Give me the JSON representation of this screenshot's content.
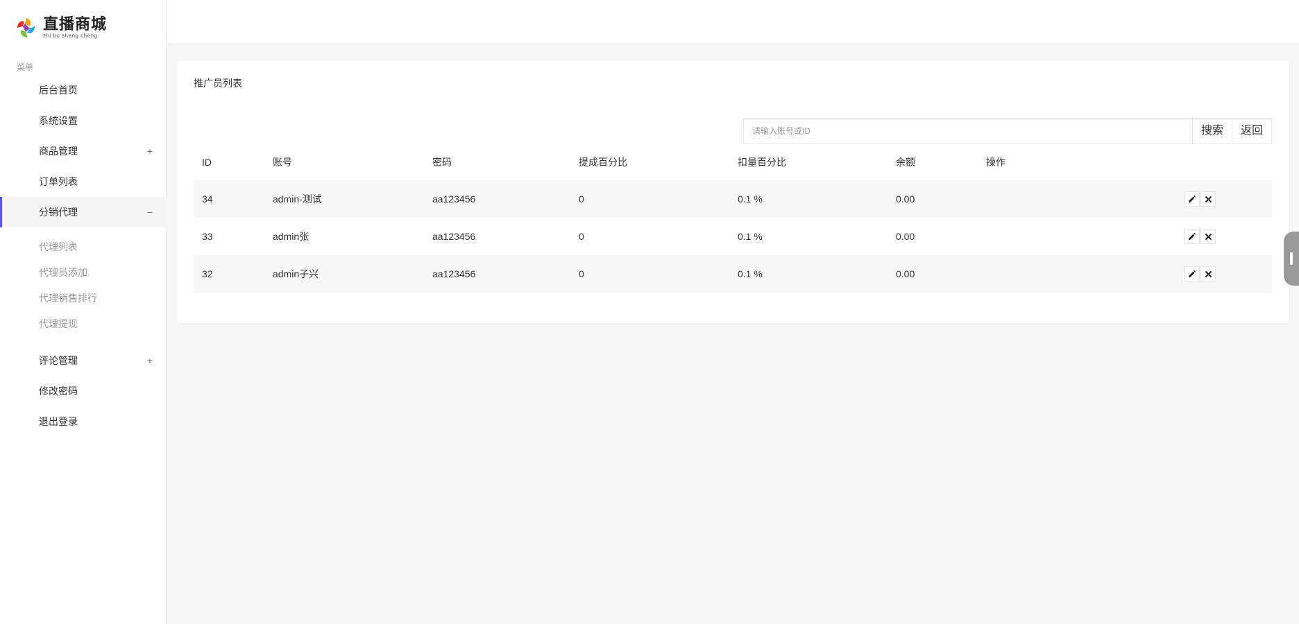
{
  "brand": {
    "title": "直播商城",
    "subtitle": "zhi bo shang cheng"
  },
  "sidebar": {
    "caption": "菜单",
    "items": [
      {
        "label": "后台首页"
      },
      {
        "label": "系统设置"
      },
      {
        "label": "商品管理",
        "toggle": "+"
      },
      {
        "label": "订单列表"
      },
      {
        "label": "分销代理",
        "toggle": "−",
        "active": true
      },
      {
        "label": "评论管理",
        "toggle": "+"
      },
      {
        "label": "修改密码"
      },
      {
        "label": "退出登录"
      }
    ],
    "sub_items": [
      {
        "label": "代理列表"
      },
      {
        "label": "代理员添加"
      },
      {
        "label": "代理销售排行"
      },
      {
        "label": "代理提现"
      }
    ]
  },
  "main": {
    "title": "推广员列表",
    "search": {
      "placeholder": "请输入账号或ID",
      "value": "",
      "search_label": "搜索",
      "back_label": "返回"
    },
    "table": {
      "columns": [
        "ID",
        "账号",
        "密码",
        "提成百分比",
        "扣量百分比",
        "余额",
        "操作"
      ],
      "rows": [
        {
          "id": "34",
          "account": "admin-测试",
          "password": "aa123456",
          "commission": "0",
          "deduction": "0.1 %",
          "balance": "0.00"
        },
        {
          "id": "33",
          "account": "admin张",
          "password": "aa123456",
          "commission": "0",
          "deduction": "0.1 %",
          "balance": "0.00"
        },
        {
          "id": "32",
          "account": "admin子兴",
          "password": "aa123456",
          "commission": "0",
          "deduction": "0.1 %",
          "balance": "0.00"
        }
      ]
    }
  },
  "colors": {
    "accent": "#5a55f5",
    "background": "#f7f7f7"
  },
  "icons": {
    "edit": "pencil-icon",
    "delete": "close-icon"
  }
}
